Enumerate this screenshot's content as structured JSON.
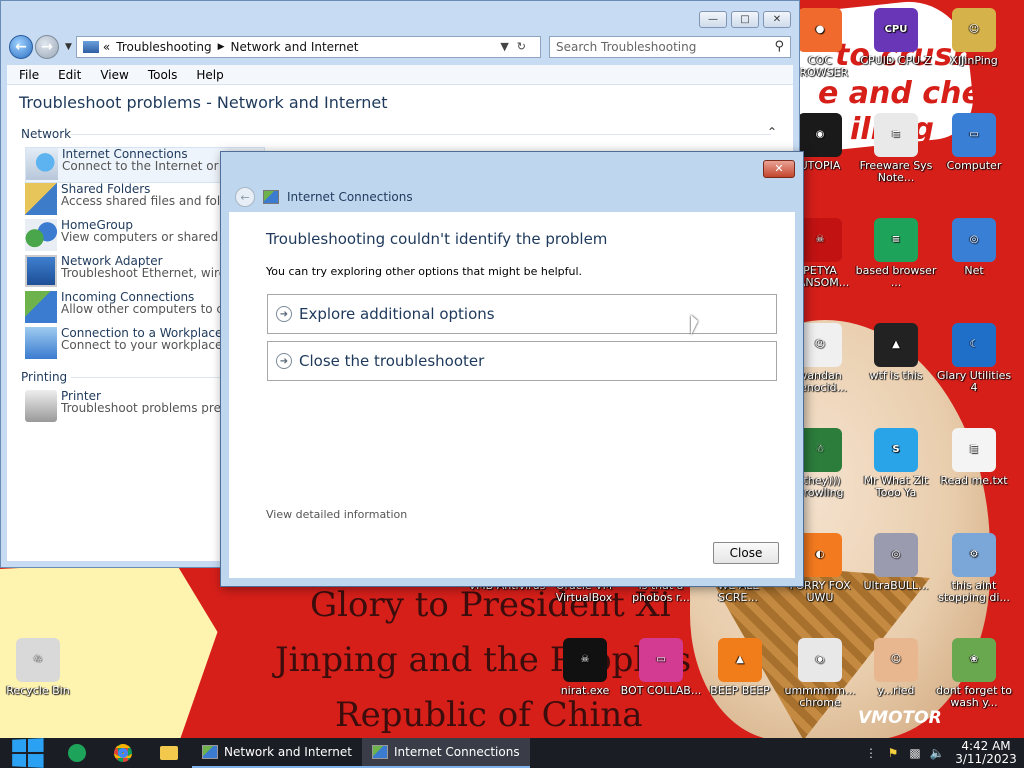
{
  "desktop": {
    "wallpaper_lines": [
      "Glory to President Xi",
      "Jinping and the People's",
      "Republic of China"
    ],
    "scrawl_top": [
      "to crush",
      "e and chew",
      "illing"
    ],
    "watermark": "VMOTOR",
    "icons": [
      {
        "label": "COC BROWSER",
        "color": "#ef6a2c",
        "glyph": "●",
        "name": "coc-browser-icon"
      },
      {
        "label": "CPUID CPU-Z",
        "color": "#6a36b8",
        "glyph": "CPU",
        "name": "cpuz-icon"
      },
      {
        "label": "XIJinPing",
        "color": "#d6b24b",
        "glyph": "☺",
        "name": "xijinping-folder-icon"
      },
      {
        "label": "UTOPIA",
        "color": "#1a1a1a",
        "glyph": "◉",
        "name": "utopia-icon"
      },
      {
        "label": "Freeware Sys Note...",
        "color": "#e9e9e9",
        "glyph": "≡",
        "name": "freeware-sysnote-icon"
      },
      {
        "label": "Computer",
        "color": "#3a7fd6",
        "glyph": "▭",
        "name": "computer-icon"
      },
      {
        "label": "PETYA RANSOM...",
        "color": "#c21212",
        "glyph": "☠",
        "name": "petya-icon"
      },
      {
        "label": "based browser ...",
        "color": "#1ea35a",
        "glyph": "≡",
        "name": "based-browser-icon"
      },
      {
        "label": "Net",
        "color": "#3a7fd6",
        "glyph": "◎",
        "name": "network-icon"
      },
      {
        "label": "wandan genocid...",
        "color": "#f0f0f0",
        "glyph": "☺",
        "name": "wandan-icon"
      },
      {
        "label": "wtf is this",
        "color": "#222",
        "glyph": "▲",
        "name": "wtf-is-this-icon"
      },
      {
        "label": "Glary Utilities 4",
        "color": "#1f6fc9",
        "glyph": "☾",
        "name": "glary-utilities-icon"
      },
      {
        "label": "(they))) growling",
        "color": "#2c7d3c",
        "glyph": "☃",
        "name": "growling-icon"
      },
      {
        "label": "Mr What Zit Tooo Ya",
        "color": "#2aa4e8",
        "glyph": "S",
        "name": "skype-icon"
      },
      {
        "label": "Read me.txt",
        "color": "#f4f4f4",
        "glyph": "≣",
        "name": "readme-txt-icon"
      },
      {
        "label": "FURRY FOX UWU",
        "color": "#f47a1f",
        "glyph": "◐",
        "name": "firefox-icon"
      },
      {
        "label": "UltraBULL...",
        "color": "#9b9bb0",
        "glyph": "◎",
        "name": "ultrabull-icon"
      },
      {
        "label": "this aint stopping di...",
        "color": "#7aa6d8",
        "glyph": "⚙",
        "name": "this-aint-stopping-icon"
      },
      {
        "label": "VMB Antivirus",
        "color": "#d71f1a",
        "glyph": "",
        "name": "vmb-antivirus-icon"
      },
      {
        "label": "Oracle VM VirtualBox",
        "color": "#d71f1a",
        "glyph": "",
        "name": "virtualbox-icon"
      },
      {
        "label": "is that a phobos r...",
        "color": "#d71f1a",
        "glyph": "",
        "name": "phobos-icon"
      },
      {
        "label": "WE ALL SCRE...",
        "color": "#d71f1a",
        "glyph": "",
        "name": "we-all-scream-icon"
      },
      {
        "label": "nirat.exe",
        "color": "#111",
        "glyph": "☠",
        "name": "nirat-icon"
      },
      {
        "label": "BOT COLLAB...",
        "color": "#d23b91",
        "glyph": "▭",
        "name": "bot-collab-icon"
      },
      {
        "label": "BEEP BEEP",
        "color": "#f07c1a",
        "glyph": "▲",
        "name": "vlc-icon"
      },
      {
        "label": "ummmmm... chrome",
        "color": "#e8e8e8",
        "glyph": "◉",
        "name": "chrome-icon"
      },
      {
        "label": "y...ried",
        "color": "#e9b78f",
        "glyph": "☺",
        "name": "face-icon"
      },
      {
        "label": "dont forget to wash y...",
        "color": "#6aa84f",
        "glyph": "❀",
        "name": "dont-forget-icon"
      },
      {
        "label": "Recycle Bin",
        "color": "#d9d9d9",
        "glyph": "♲",
        "name": "recycle-bin-icon"
      }
    ]
  },
  "explorer": {
    "address": {
      "prefix": "«",
      "crumbs": [
        "Troubleshooting",
        "Network and Internet"
      ]
    },
    "search_placeholder": "Search Troubleshooting",
    "menu": [
      "File",
      "Edit",
      "View",
      "Tools",
      "Help"
    ],
    "page_title": "Troubleshoot problems - Network and Internet",
    "sections": {
      "network": "Network",
      "printing": "Printing"
    },
    "items": [
      {
        "name": "Internet Connections",
        "desc": "Connect to the Internet or to"
      },
      {
        "name": "Shared Folders",
        "desc": "Access shared files and folde"
      },
      {
        "name": "HomeGroup",
        "desc": "View computers or shared file"
      },
      {
        "name": "Network Adapter",
        "desc": "Troubleshoot Ethernet, wirele"
      },
      {
        "name": "Incoming Connections",
        "desc": "Allow other computers to co"
      },
      {
        "name": "Connection to a Workplace U",
        "desc": "Connect to your workplace ne"
      }
    ],
    "printer": {
      "name": "Printer",
      "desc": "Troubleshoot problems preve"
    }
  },
  "dialog": {
    "title": "Internet Connections",
    "heading": "Troubleshooting couldn't identify the problem",
    "subtext": "You can try exploring other options that might be helpful.",
    "options": [
      "Explore additional options",
      "Close the troubleshooter"
    ],
    "details_link": "View detailed information",
    "close_button": "Close"
  },
  "taskbar": {
    "tasks": [
      "Network and Internet",
      "Internet Connections"
    ],
    "clock_time": "4:42 AM",
    "clock_date": "3/11/2023"
  }
}
